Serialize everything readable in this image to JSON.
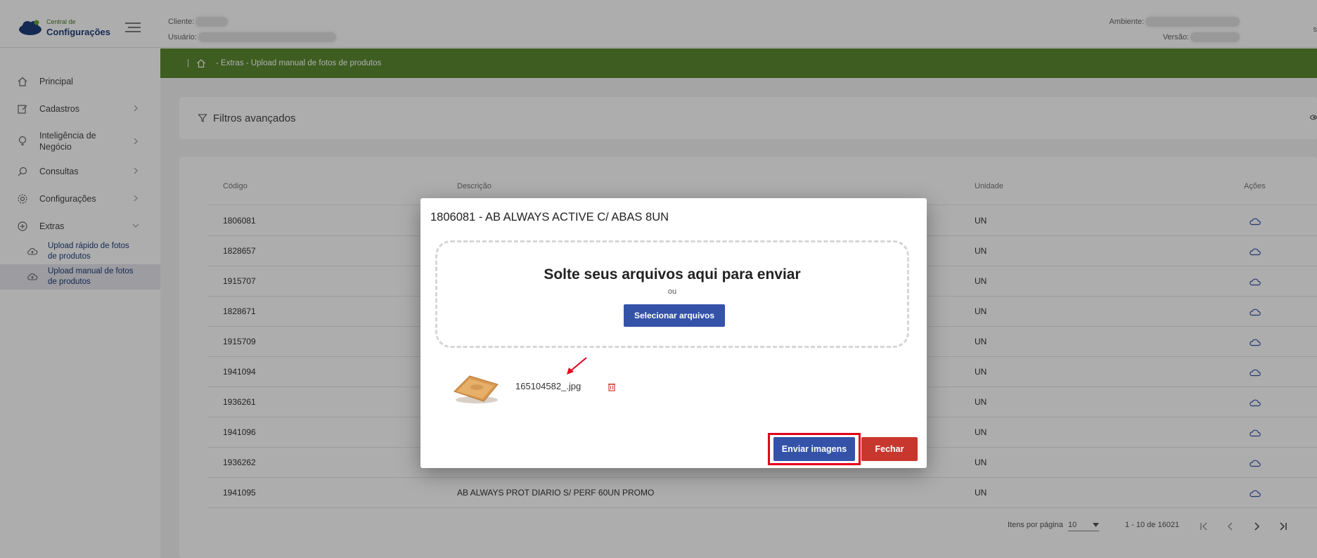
{
  "header": {
    "logo_small": "Central de",
    "logo_big": "Configurações",
    "cliente_label": "Cliente:",
    "usuario_label": "Usuário:",
    "ambiente_label": "Ambiente:",
    "versao_label": "Versão:",
    "edge_char": "s"
  },
  "sidebar": {
    "items": [
      {
        "label": "Principal",
        "icon": "home-icon"
      },
      {
        "label": "Cadastros",
        "icon": "edit-icon"
      },
      {
        "label": "Inteligência de Negócio",
        "icon": "lightbulb-icon"
      },
      {
        "label": "Consultas",
        "icon": "search-icon"
      },
      {
        "label": "Configurações",
        "icon": "gear-icon"
      },
      {
        "label": "Extras",
        "icon": "plus-circle-icon"
      }
    ],
    "subitems": [
      {
        "label": "Upload rápido de fotos de produtos",
        "icon": "cloud-upload-icon"
      },
      {
        "label": "Upload manual de fotos de produtos",
        "icon": "cloud-upload-icon"
      }
    ]
  },
  "breadcrumb": {
    "separator": "|",
    "text": "- Extras - Upload manual de fotos de produtos"
  },
  "filters": {
    "title": "Filtros avançados"
  },
  "table": {
    "columns": [
      "Código",
      "Descrição",
      "Unidade",
      "Ações"
    ],
    "rows": [
      {
        "codigo": "1806081",
        "descricao": "",
        "unidade": "UN"
      },
      {
        "codigo": "1828657",
        "descricao": "",
        "unidade": "UN"
      },
      {
        "codigo": "1915707",
        "descricao": "",
        "unidade": "UN"
      },
      {
        "codigo": "1828671",
        "descricao": "",
        "unidade": "UN"
      },
      {
        "codigo": "1915709",
        "descricao": "",
        "unidade": "UN"
      },
      {
        "codigo": "1941094",
        "descricao": "",
        "unidade": "UN"
      },
      {
        "codigo": "1936261",
        "descricao": "",
        "unidade": "UN"
      },
      {
        "codigo": "1941096",
        "descricao": "",
        "unidade": "UN"
      },
      {
        "codigo": "1936262",
        "descricao": "",
        "unidade": "UN"
      },
      {
        "codigo": "1941095",
        "descricao": "AB ALWAYS PROT DIARIO S/ PERF 60UN PROMO",
        "unidade": "UN"
      }
    ]
  },
  "paginator": {
    "items_label": "Itens por página",
    "page_size": "10",
    "range": "1 - 10 de 16021"
  },
  "modal": {
    "title": "1806081 - AB ALWAYS ACTIVE C/ ABAS 8UN",
    "drop_title": "Solte seus arquivos aqui para enviar",
    "drop_or": "ou",
    "select_button": "Selecionar arquivos",
    "file_name": "165104582_.jpg",
    "send_button": "Enviar imagens",
    "close_button": "Fechar"
  },
  "colors": {
    "breadcrumb_bg": "#5c8a32",
    "primary_button": "#3453a8",
    "close_button": "#c8372d",
    "highlight": "#e3001b"
  }
}
